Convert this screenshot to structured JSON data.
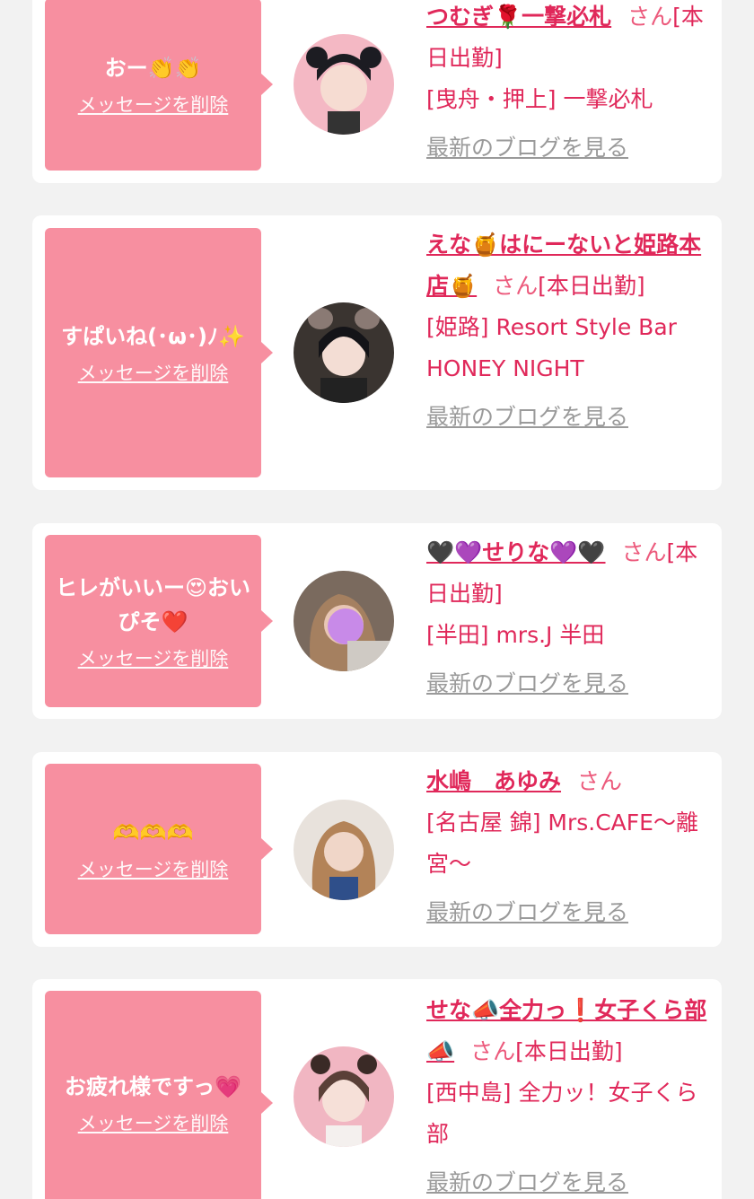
{
  "delete_label": "メッセージを削除",
  "blog_label": "最新のブログを見る",
  "san_label": "さん",
  "colors": {
    "background": "#f2f2f2",
    "card": "#ffffff",
    "bubble": "#f78fa0",
    "accent": "#e0285a",
    "link_gray": "#9a9a9a"
  },
  "cards": [
    {
      "message": "おー👏👏",
      "name": "つむぎ🌹一撃必札",
      "status": "[本日出勤]",
      "shop": "[曳舟・押上] 一撃必札",
      "avatar_icon": "profile-photo"
    },
    {
      "message": "すぱいね(･ω･)ﾉ✨",
      "name": "えな🍯はにーないと姫路本店🍯",
      "status": "[本日出勤]",
      "shop": "[姫路] Resort Style Bar HONEY NIGHT",
      "avatar_icon": "profile-photo"
    },
    {
      "message": "ヒレがいいー😍おいぴそ❤️",
      "name": "🖤💜せりな💜🖤",
      "status": "[本日出勤]",
      "shop": "[半田] mrs.J 半田",
      "avatar_icon": "profile-photo"
    },
    {
      "message": "🫶🫶🫶",
      "name": "水嶋　あゆみ",
      "status": "",
      "shop": "[名古屋 錦] Mrs.CAFE〜離宮〜",
      "avatar_icon": "profile-photo"
    },
    {
      "message": "お疲れ様ですっ💗",
      "name": "せな📣全力っ❗️女子くら部📣",
      "status": "[本日出勤]",
      "shop": "[西中島] 全力ッ！女子くら部",
      "avatar_icon": "profile-photo"
    }
  ]
}
